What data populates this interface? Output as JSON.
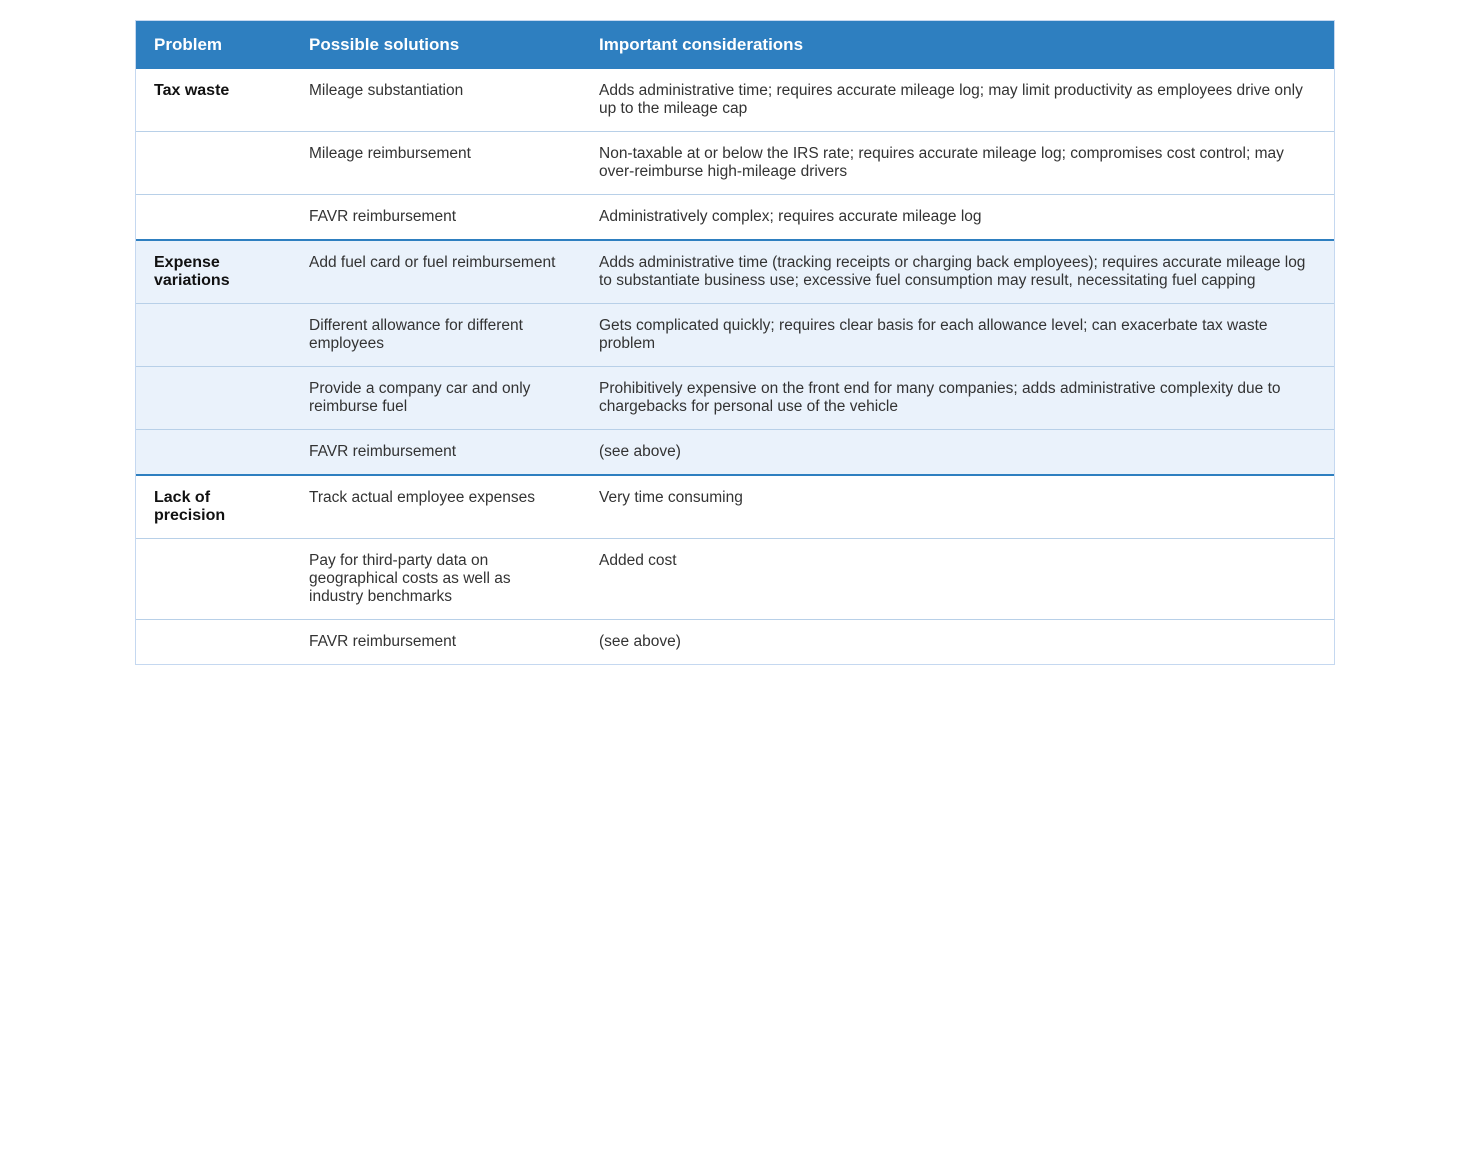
{
  "table": {
    "headers": {
      "problem": "Problem",
      "solutions": "Possible solutions",
      "considerations": "Important considerations"
    },
    "sections": [
      {
        "id": "tax-waste",
        "problem": "Tax waste",
        "bgClass": "section-tax",
        "rows": [
          {
            "solution": "Mileage substantiation",
            "consideration": "Adds administrative time; requires accurate mileage log; may limit productivity as employees drive only up to the mileage cap"
          },
          {
            "solution": "Mileage reimbursement",
            "consideration": "Non-taxable at or below the IRS rate; requires accurate mileage log; compromises cost control; may over-reimburse high-mileage drivers"
          },
          {
            "solution": "FAVR reimbursement",
            "consideration": "Administratively complex; requires accurate mileage log"
          }
        ]
      },
      {
        "id": "expense-variations",
        "problem": "Expense variations",
        "bgClass": "section-expense",
        "rows": [
          {
            "solution": "Add fuel card or fuel reimbursement",
            "consideration": "Adds administrative time (tracking receipts or charging back employees); requires accurate mileage log to substantiate business use; excessive fuel consumption may result, necessitating fuel capping"
          },
          {
            "solution": "Different allowance for different employees",
            "consideration": "Gets complicated quickly; requires clear basis for each allowance level; can exacerbate tax waste problem"
          },
          {
            "solution": "Provide a company car and only reimburse fuel",
            "consideration": "Prohibitively expensive on the front end for many companies; adds administrative complexity due to chargebacks for personal use of the vehicle"
          },
          {
            "solution": "FAVR reimbursement",
            "consideration": "(see above)"
          }
        ]
      },
      {
        "id": "lack-of-precision",
        "problem": "Lack of precision",
        "bgClass": "section-precision",
        "rows": [
          {
            "solution": "Track actual employee expenses",
            "consideration": "Very time consuming"
          },
          {
            "solution": "Pay for third-party data on geographical costs as well as industry benchmarks",
            "consideration": "Added cost"
          },
          {
            "solution": "FAVR reimbursement",
            "consideration": "(see above)"
          }
        ]
      }
    ]
  }
}
